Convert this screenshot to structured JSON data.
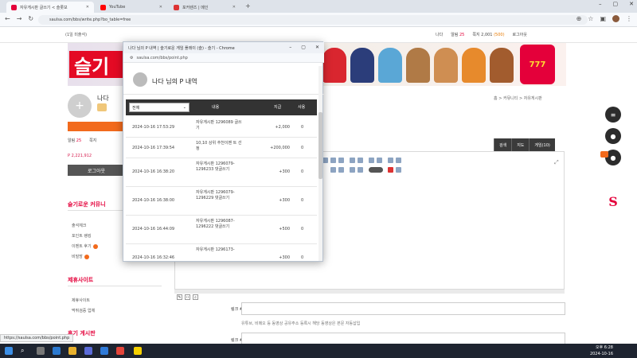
{
  "browser": {
    "tabs": [
      {
        "label": "자유게시판 글쓰기 < 슬롯보"
      },
      {
        "label": "YouTube"
      },
      {
        "label": "포커렌즈 | 메인"
      }
    ],
    "url": "saulsa.com/bbs/write.php?bo_table=free"
  },
  "topbar": {
    "greeting": "(1일 미출석)",
    "name": "나다",
    "level_label": "알림",
    "level": "25",
    "points_label": "쪽지",
    "points": "2,001",
    "points_extra": "(500)",
    "logout": "로그아웃"
  },
  "profile": {
    "name": "나다",
    "stats": [
      {
        "label": "알림",
        "value": "25"
      },
      {
        "label": "쪽지",
        "value": ""
      }
    ],
    "point": "P 2,221,912",
    "logout_button": "로그아웃"
  },
  "sidebar": {
    "section1_title": "슬기로운 커뮤니",
    "section1_items": [
      "출석체크",
      "포인트 랭킹",
      "이벤트 후기",
      "비밀방"
    ],
    "section2_title": "제휴사이트",
    "section2_items": [
      "제휴사이트",
      "먹튀검증 업체"
    ],
    "section3_title": "후기 게시판"
  },
  "main": {
    "breadcrumb": "홈 > 커뮤니티 > 자유게시판",
    "editor_tabs": [
      "검색",
      "지도",
      "게임(10)"
    ],
    "link1_label": "링크 #1",
    "link2_label": "링크 #2",
    "link_note": "유튜브, 비메오 등 동영상 공유주소 등록시 해당 동영상은 본문 자동삽입"
  },
  "popup": {
    "window_title": "나다 님의 P 내역 | 슬기로운 게임 플레이 (슬) - 슬기 - Chrome",
    "url": "saulsa.com/bbs/point.php",
    "heading": "나다 님의 P 내역",
    "filter": "전체",
    "headers": {
      "content": "내용",
      "amount": "지급",
      "balance": "사용"
    },
    "rows": [
      {
        "date": "2024-10-16 17:53:29",
        "content": "자유게시판 1296089 글쓰기",
        "amount": "+2,000",
        "balance": "0"
      },
      {
        "date": "2024-10-16 17:39:54",
        "content": "10,10 상위 추천이벤 트 선정",
        "amount": "+200,000",
        "balance": "0"
      },
      {
        "date": "2024-10-16 16:38:20",
        "content": "자유게시판 1296079- 1296233 댓글쓰기",
        "amount": "+300",
        "balance": "0"
      },
      {
        "date": "2024-10-16 16:38:00",
        "content": "자유게시판 1296079- 1296229 댓글쓰기",
        "amount": "+300",
        "balance": "0"
      },
      {
        "date": "2024-10-16 16:44:09",
        "content": "자유게시판 1296087- 1296222 댓글쓰기",
        "amount": "+500",
        "balance": "0"
      },
      {
        "date": "2024-10-16 16:32:46",
        "content": "자유게시판 1296173-",
        "amount": "+300",
        "balance": "0"
      }
    ]
  },
  "status_url": "https://saulsa.com/bbs/point.php",
  "clock": {
    "time": "오후 6:28",
    "date": "2024-10-16"
  },
  "colors": {
    "brand": "#e4003a",
    "orange": "#f26a1c",
    "dark": "#333333"
  }
}
